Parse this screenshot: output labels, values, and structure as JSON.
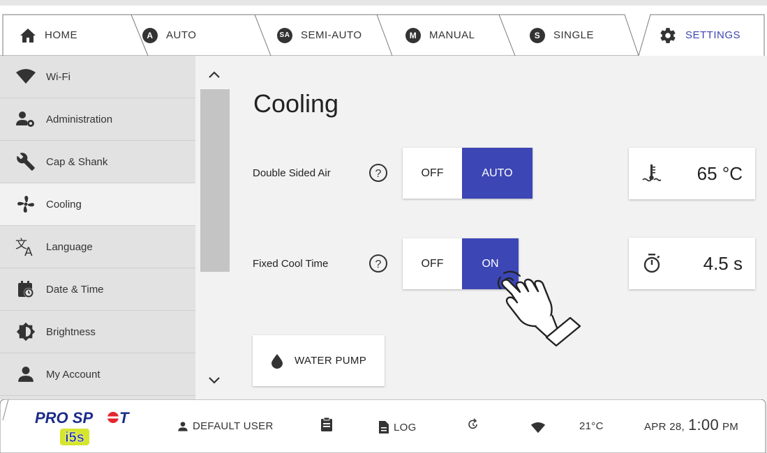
{
  "tabs": [
    {
      "label": "HOME",
      "icon": "home-icon"
    },
    {
      "label": "AUTO",
      "badge": "A"
    },
    {
      "label": "SEMI-AUTO",
      "badge": "SA"
    },
    {
      "label": "MANUAL",
      "badge": "M"
    },
    {
      "label": "SINGLE",
      "badge": "S"
    },
    {
      "label": "SETTINGS",
      "icon": "gear-icon",
      "active": true
    }
  ],
  "sidebar": {
    "items": [
      {
        "label": "Wi-Fi",
        "icon": "wifi-icon"
      },
      {
        "label": "Administration",
        "icon": "admin-icon"
      },
      {
        "label": "Cap & Shank",
        "icon": "wrench-icon"
      },
      {
        "label": "Cooling",
        "icon": "fan-icon",
        "active": true
      },
      {
        "label": "Language",
        "icon": "translate-icon"
      },
      {
        "label": "Date & Time",
        "icon": "calendar-clock-icon"
      },
      {
        "label": "Brightness",
        "icon": "brightness-icon"
      },
      {
        "label": "My Account",
        "icon": "person-icon"
      }
    ]
  },
  "main": {
    "title": "Cooling",
    "double_sided_air": {
      "label": "Double Sided Air",
      "off": "OFF",
      "on": "AUTO",
      "selected": "AUTO"
    },
    "fixed_cool_time": {
      "label": "Fixed Cool Time",
      "off": "OFF",
      "on": "ON",
      "selected": "ON"
    },
    "temperature": {
      "value": "65 °C",
      "icon": "coolant-temp-icon"
    },
    "cool_time": {
      "value": "4.5 s",
      "icon": "timer-icon"
    },
    "water_pump": {
      "label": "WATER PUMP",
      "icon": "water-drop-icon"
    }
  },
  "status_bar": {
    "brand_top": "PRO SP",
    "brand_bottom": "i5s",
    "user": "DEFAULT USER",
    "log": "LOG",
    "temperature": "21°C",
    "date": "APR 28,",
    "time": "1:00",
    "ampm": "PM"
  },
  "colors": {
    "accent": "#3c46b4",
    "sidebar": "#e2e2e2",
    "background": "#f2f2f2",
    "brand_red": "#e4262f"
  }
}
